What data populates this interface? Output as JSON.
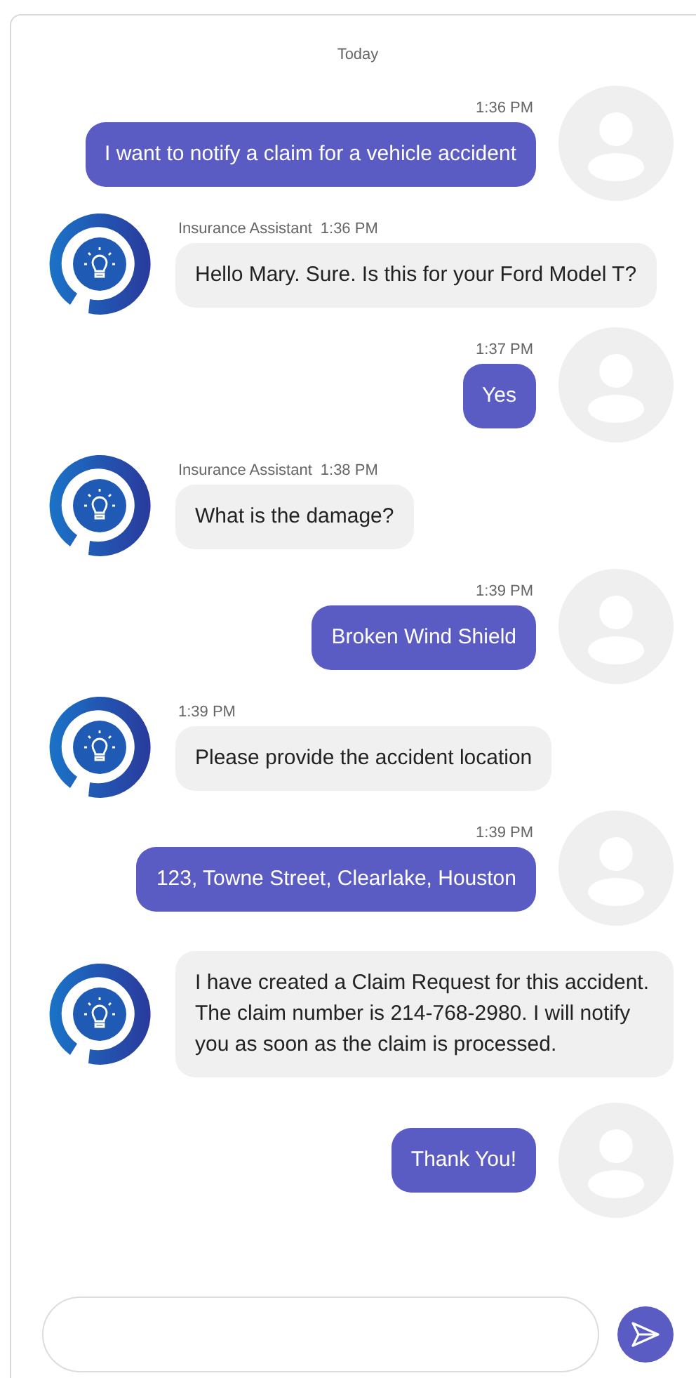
{
  "date_divider": "Today",
  "messages": [
    {
      "kind": "user",
      "time": "1:36 PM",
      "text": "I want to notify a claim for a vehicle accident"
    },
    {
      "kind": "bot",
      "sender": "Insurance Assistant",
      "time": "1:36 PM",
      "text": "Hello Mary. Sure. Is this for your Ford Model T?"
    },
    {
      "kind": "user",
      "time": "1:37 PM",
      "text": "Yes"
    },
    {
      "kind": "bot",
      "sender": "Insurance Assistant",
      "time": "1:38 PM",
      "text": "What is the damage?"
    },
    {
      "kind": "user",
      "time": "1:39 PM",
      "text": "Broken Wind Shield"
    },
    {
      "kind": "bot",
      "time": "1:39 PM",
      "text": "Please provide the accident location"
    },
    {
      "kind": "user",
      "time": "1:39 PM",
      "text": "123, Towne Street, Clearlake, Houston"
    },
    {
      "kind": "bot",
      "text": "I have created a Claim Request for this accident. The claim number is 214-768-2980. I will notify you as soon as the claim is processed."
    },
    {
      "kind": "user",
      "text": "Thank You!"
    }
  ]
}
